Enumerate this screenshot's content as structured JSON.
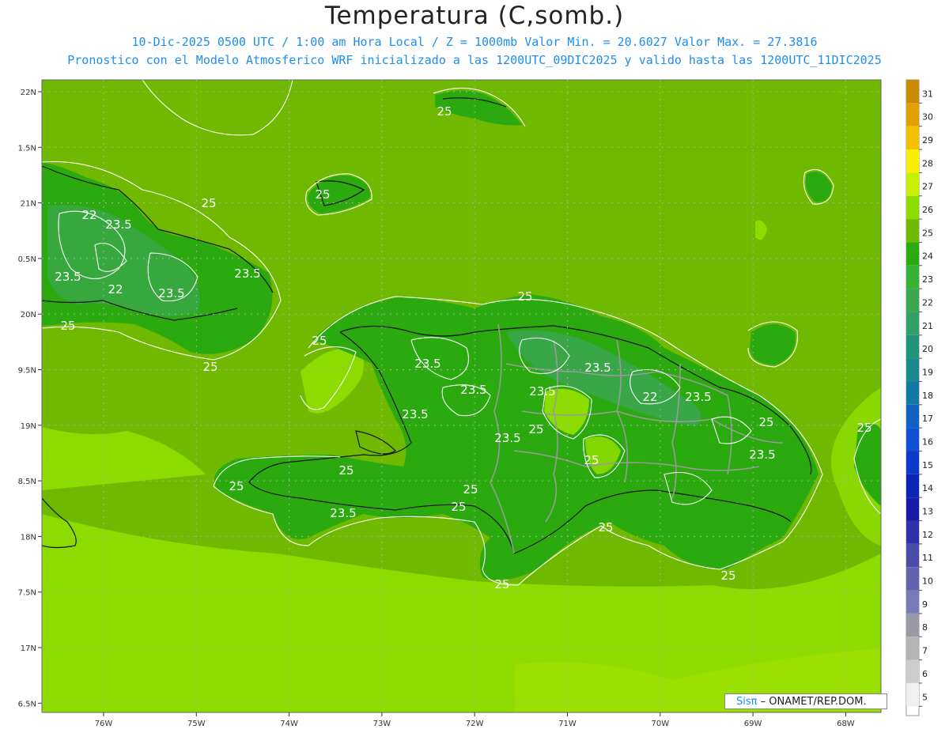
{
  "header": {
    "title": "Temperatura (C,somb.)",
    "line1": "10-Dic-2025  0500 UTC / 1:00 am Hora Local / Z = 1000mb   Valor Min. = 20.6027  Valor Max. = 27.3816",
    "line2": "Pronostico con el Modelo Atmosferico WRF inicializado a las 1200UTC_09DIC2025 y valido hasta las  1200UTC_11DIC2025"
  },
  "axes": {
    "lat_labels": [
      "22N",
      "1.5N",
      "21N",
      "0.5N",
      "20N",
      "9.5N",
      "19N",
      "8.5N",
      "18N",
      "7.5N",
      "17N",
      "6.5N"
    ],
    "lon_labels": [
      "76W",
      "75W",
      "74W",
      "73W",
      "72W",
      "71W",
      "70W",
      "69W",
      "68W"
    ]
  },
  "colorbar": {
    "levels": [
      "31",
      "30",
      "29",
      "28",
      "27",
      "26",
      "25",
      "24",
      "23",
      "22",
      "21",
      "20",
      "19",
      "18",
      "17",
      "16",
      "15",
      "14",
      "13",
      "12",
      "11",
      "10",
      "9",
      "8",
      "7",
      "6",
      "5"
    ],
    "colors": [
      "#c78a00",
      "#e0a200",
      "#f5c000",
      "#f8f000",
      "#c8f000",
      "#8cdc00",
      "#6fba00",
      "#2aaa0e",
      "#38b233",
      "#3ca652",
      "#32a068",
      "#21957a",
      "#178a8e",
      "#1478a6",
      "#1262c2",
      "#1050d4",
      "#0d3ac8",
      "#0a24b8",
      "#1a1aa8",
      "#3030a8",
      "#4b4ba8",
      "#6262ae",
      "#7a7ab8",
      "#9a9aa6",
      "#b4b4b4",
      "#cccccc",
      "#f0f0f0"
    ]
  },
  "contour_labels": [
    "25",
    "25",
    "22",
    "23.5",
    "23.5",
    "22",
    "23.5",
    "23.5",
    "25",
    "25",
    "25",
    "25",
    "25",
    "23.5",
    "23.5",
    "23.5",
    "25",
    "23.5",
    "23.5",
    "22",
    "23.5",
    "25",
    "25",
    "23.5",
    "23.5",
    "25",
    "25",
    "25",
    "25",
    "23.5",
    "25",
    "25",
    "25",
    "25"
  ],
  "credit": {
    "sis": "Sisπ",
    "org": " – ONAMET/REP.DOM."
  }
}
